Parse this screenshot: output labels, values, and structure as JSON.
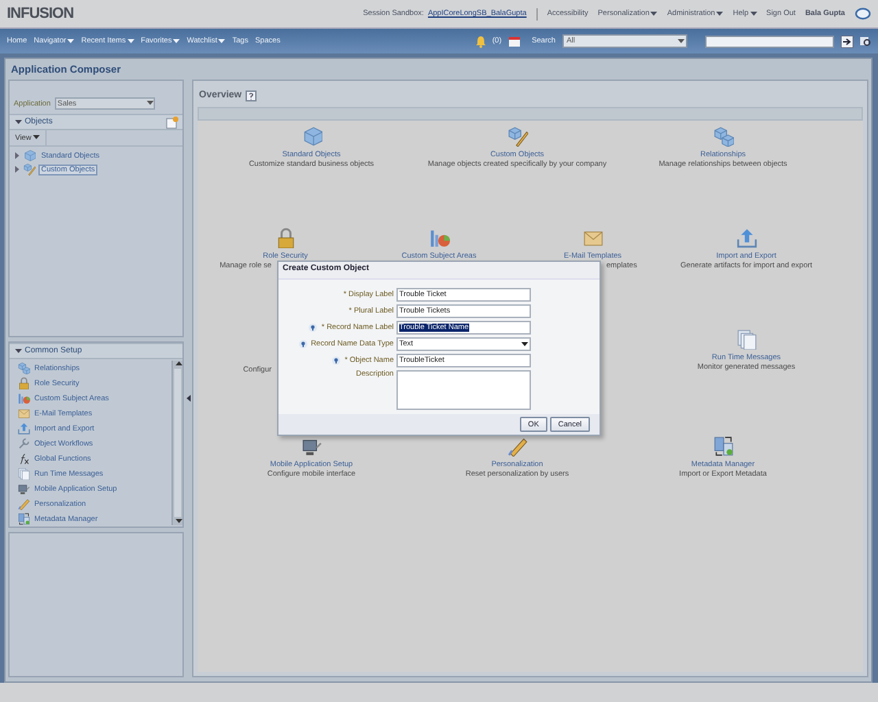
{
  "header": {
    "logo": "INFUSION",
    "session_label": "Session Sandbox:",
    "session_link": "AppICoreLongSB_BalaGupta",
    "links": [
      {
        "label": "Accessibility",
        "menu": false
      },
      {
        "label": "Personalization",
        "menu": true
      },
      {
        "label": "Administration",
        "menu": true
      },
      {
        "label": "Help",
        "menu": true
      },
      {
        "label": "Sign Out",
        "menu": false
      }
    ],
    "user": "Bala Gupta"
  },
  "nav": {
    "items": [
      {
        "label": "Home",
        "menu": false
      },
      {
        "label": "Navigator",
        "menu": true
      },
      {
        "label": "Recent Items",
        "menu": true
      },
      {
        "label": "Favorites",
        "menu": true
      },
      {
        "label": "Watchlist",
        "menu": true
      },
      {
        "label": "Tags",
        "menu": false
      },
      {
        "label": "Spaces",
        "menu": false
      }
    ],
    "notifications": "(0)",
    "search_label": "Search",
    "search_scope": "All"
  },
  "page_title": "Application Composer",
  "left": {
    "application_label": "Application",
    "application_value": "Sales",
    "objects": {
      "title": "Objects",
      "expanded": true,
      "view_menu": "View",
      "tree": [
        {
          "label": "Standard Objects",
          "selected": false,
          "expanded": false
        },
        {
          "label": "Custom Objects",
          "selected": true,
          "expanded": false
        }
      ]
    },
    "common_setup": {
      "title": "Common Setup",
      "expanded": true,
      "items": [
        "Relationships",
        "Role Security",
        "Custom Subject Areas",
        "E-Mail Templates",
        "Import and Export",
        "Object Workflows",
        "Global Functions",
        "Run Time Messages",
        "Mobile Application Setup",
        "Personalization",
        "Metadata Manager"
      ]
    }
  },
  "overview": {
    "title": "Overview",
    "rows": [
      [
        {
          "title": "Standard Objects",
          "description": "Customize standard business objects"
        },
        {
          "title": "Custom Objects",
          "description": "Manage objects created specifically by your company"
        },
        {
          "title": "Relationships",
          "description": "Manage relationships between objects"
        }
      ],
      [
        {
          "title": "Role Security",
          "description": "Manage role se"
        },
        {
          "title": "Custom Subject Areas"
        },
        {
          "title": "E-Mail Templates",
          "description": "emplates"
        },
        {
          "title": "Import and Export",
          "description": "Generate artifacts for import and export"
        }
      ],
      [
        {
          "description": "Configur"
        },
        "",
        "",
        {
          "title": "Run Time Messages",
          "description": "Monitor generated messages"
        }
      ],
      [
        {
          "title": "Mobile Application Setup",
          "description": "Configure mobile interface"
        },
        {
          "title": "Personalization",
          "description": "Reset personalization by users"
        },
        {
          "title": "Metadata Manager",
          "description": "Import or Export Metadata"
        }
      ]
    ]
  },
  "dialog": {
    "title": "Create Custom Object",
    "fields": [
      {
        "kind": "text",
        "label": "* Display Label",
        "help": false,
        "value": "Trouble Ticket",
        "highlighted": false
      },
      {
        "kind": "text",
        "label": "* Plural Label",
        "help": false,
        "value": "Trouble Tickets",
        "highlighted": false
      },
      {
        "kind": "text",
        "label": "* Record Name Label",
        "help": true,
        "value": "Trouble Ticket Name",
        "highlighted": true
      },
      {
        "kind": "select",
        "label": "Record Name Data Type",
        "help": true,
        "value": "Text"
      },
      {
        "kind": "text",
        "label": "* Object Name",
        "help": true,
        "value": "TroubleTicket",
        "highlighted": false
      },
      {
        "kind": "textarea",
        "label": "Description",
        "help": false
      }
    ],
    "buttons": [
      "OK",
      "Cancel"
    ]
  }
}
